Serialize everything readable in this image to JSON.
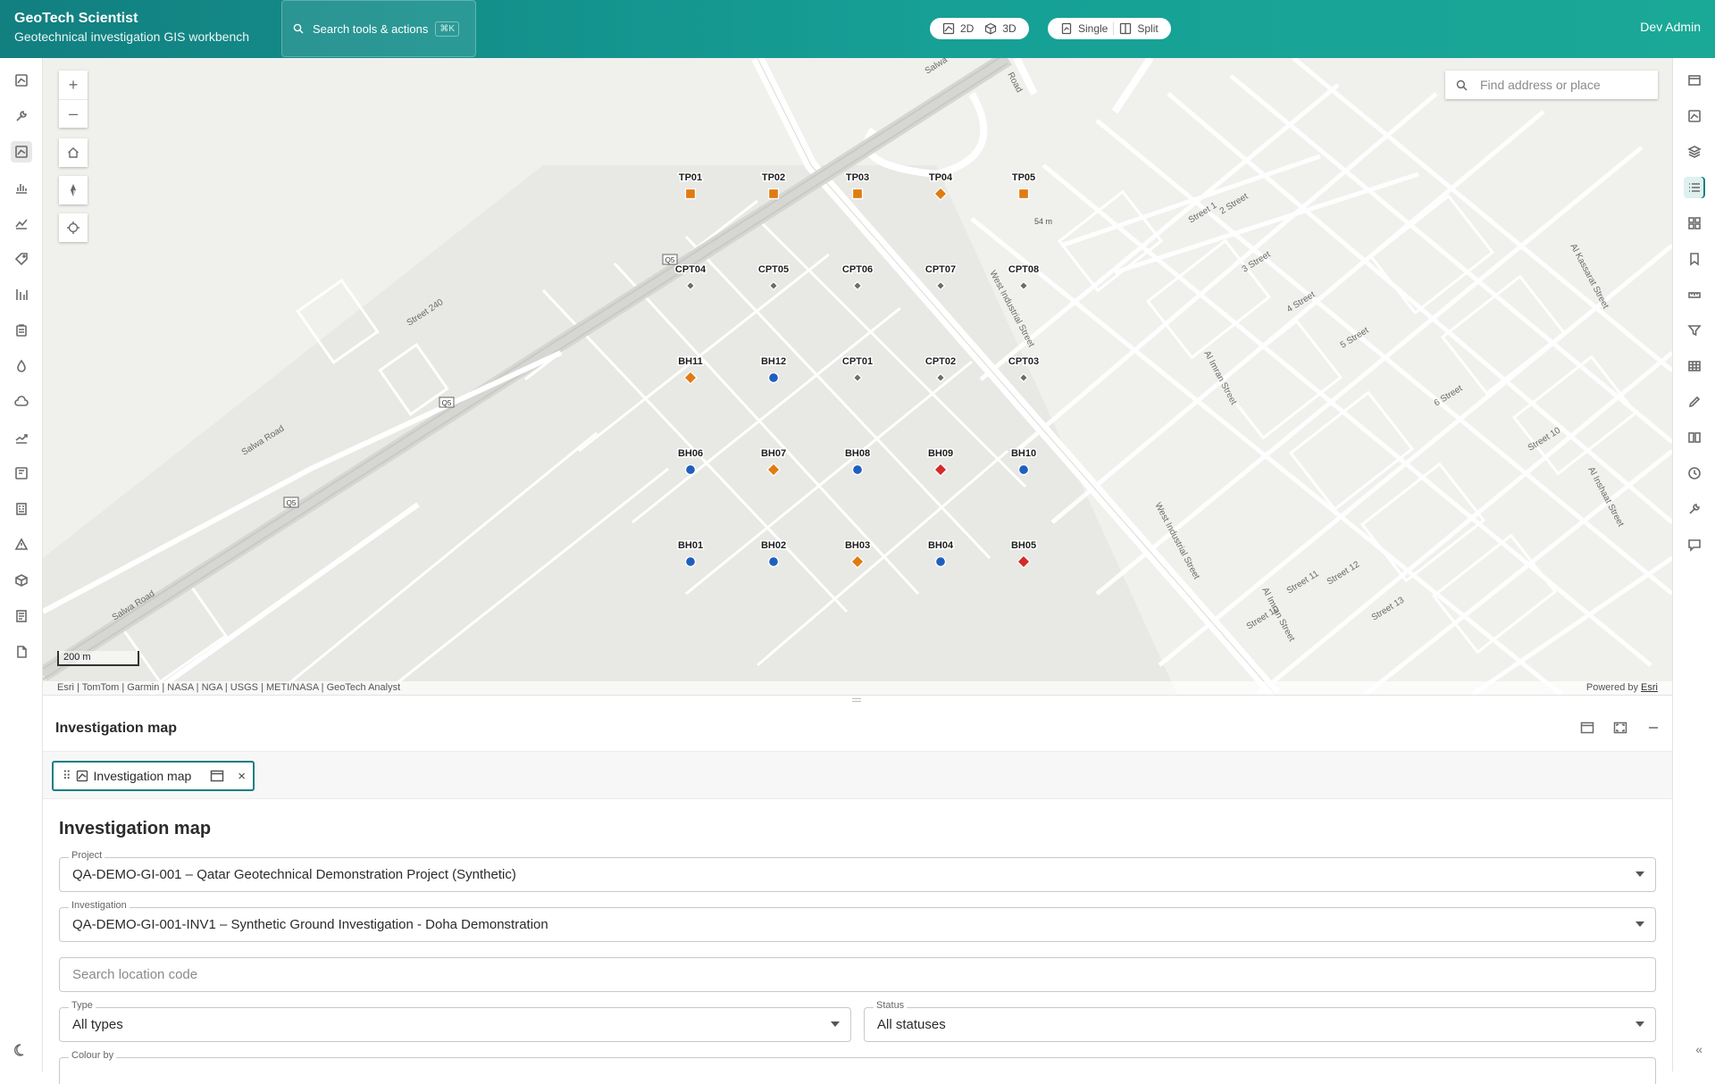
{
  "app": {
    "title": "GeoTech Scientist",
    "subtitle": "Geotechnical investigation GIS workbench",
    "user": "Dev Admin"
  },
  "command": {
    "placeholder": "Search tools & actions",
    "shortcut": "⌘K"
  },
  "view_toggle": {
    "mode_2d": "2D",
    "mode_3d": "3D",
    "single": "Single",
    "split": "Split"
  },
  "left_rail": {
    "icons": [
      "map-icon",
      "tools-icon",
      "investigation-map-icon",
      "bar-chart-icon",
      "line-chart-icon",
      "tag-icon",
      "equalizer-icon",
      "clipboard-icon",
      "drop-icon",
      "cloud-icon",
      "trend-icon",
      "map-alt-icon",
      "building-icon",
      "warning-icon",
      "cube-icon",
      "report-icon",
      "file-icon"
    ],
    "active_index": 2
  },
  "right_rail": {
    "icons": [
      "panel-icon",
      "map-icon",
      "layers-icon",
      "list-icon",
      "grid-icon",
      "bookmark-icon",
      "measure-icon",
      "filter-icon",
      "table-icon",
      "edit-icon",
      "compare-icon",
      "clock-icon",
      "tools-icon",
      "comment-icon"
    ],
    "active_index": 3
  },
  "map": {
    "find_placeholder": "Find address or place",
    "scale": "200 m",
    "attribution": "Esri | TomTom | Garmin | NASA | NGA | USGS | METI/NASA | GeoTech Analyst",
    "powered_by": "Powered by",
    "powered_link": "Esri",
    "elevation_note": "54 m",
    "street_labels": [
      "Salwa Road",
      "Street 240",
      "Salwa Road",
      "West Industrial Street",
      "West Industrial Street",
      "Al Imran Street",
      "Al Imran Street",
      "Street 1",
      "2 Street",
      "3 Street",
      "4 Street",
      "5 Street",
      "6 Street",
      "Street 10",
      "Street 10",
      "Street 11",
      "Street 12",
      "Street 13",
      "Al Kassarat Street",
      "Al Inshaat Street",
      "Road",
      "Salwa"
    ],
    "road_badges": [
      "Q5",
      "Q5",
      "Q5"
    ],
    "points": [
      {
        "code": "TP01",
        "kind": "square",
        "color": "#e07b10"
      },
      {
        "code": "TP02",
        "kind": "square",
        "color": "#e07b10"
      },
      {
        "code": "TP03",
        "kind": "square",
        "color": "#e07b10"
      },
      {
        "code": "TP04",
        "kind": "diamond",
        "color": "#e07b10"
      },
      {
        "code": "TP05",
        "kind": "square",
        "color": "#e07b10"
      },
      {
        "code": "CPT04",
        "kind": "small-diamond",
        "color": "#6b6b6b"
      },
      {
        "code": "CPT05",
        "kind": "small-diamond",
        "color": "#6b6b6b"
      },
      {
        "code": "CPT06",
        "kind": "small-diamond",
        "color": "#6b6b6b"
      },
      {
        "code": "CPT07",
        "kind": "small-diamond",
        "color": "#6b6b6b"
      },
      {
        "code": "CPT08",
        "kind": "small-diamond",
        "color": "#6b6b6b"
      },
      {
        "code": "BH11",
        "kind": "diamond",
        "color": "#e07b10"
      },
      {
        "code": "BH12",
        "kind": "circle",
        "color": "#1f5fbf"
      },
      {
        "code": "CPT01",
        "kind": "small-diamond",
        "color": "#6b6b6b"
      },
      {
        "code": "CPT02",
        "kind": "small-diamond",
        "color": "#6b6b6b"
      },
      {
        "code": "CPT03",
        "kind": "small-diamond",
        "color": "#6b6b6b"
      },
      {
        "code": "BH06",
        "kind": "circle",
        "color": "#1f5fbf"
      },
      {
        "code": "BH07",
        "kind": "diamond",
        "color": "#e07b10"
      },
      {
        "code": "BH08",
        "kind": "circle",
        "color": "#1f5fbf"
      },
      {
        "code": "BH09",
        "kind": "diamond",
        "color": "#d42a2a"
      },
      {
        "code": "BH10",
        "kind": "circle",
        "color": "#1f5fbf"
      },
      {
        "code": "BH01",
        "kind": "circle",
        "color": "#1f5fbf"
      },
      {
        "code": "BH02",
        "kind": "circle",
        "color": "#1f5fbf"
      },
      {
        "code": "BH03",
        "kind": "diamond",
        "color": "#e07b10"
      },
      {
        "code": "BH04",
        "kind": "circle",
        "color": "#1f5fbf"
      },
      {
        "code": "BH05",
        "kind": "diamond",
        "color": "#d42a2a"
      }
    ]
  },
  "panel": {
    "title": "Investigation map",
    "tab_label": "Investigation map",
    "form_title": "Investigation map",
    "project_label": "Project",
    "project_value": "QA-DEMO-GI-001 – Qatar Geotechnical Demonstration Project (Synthetic)",
    "investigation_label": "Investigation",
    "investigation_value": "QA-DEMO-GI-001-INV1 – Synthetic Ground Investigation - Doha Demonstration",
    "search_placeholder": "Search location code",
    "type_label": "Type",
    "type_value": "All types",
    "status_label": "Status",
    "status_value": "All statuses",
    "colour_label": "Colour by"
  },
  "colors": {
    "accent": "#127f80",
    "borehole": "#1f5fbf",
    "trial_pit": "#e07b10",
    "cpt": "#6b6b6b",
    "alert": "#d42a2a"
  }
}
